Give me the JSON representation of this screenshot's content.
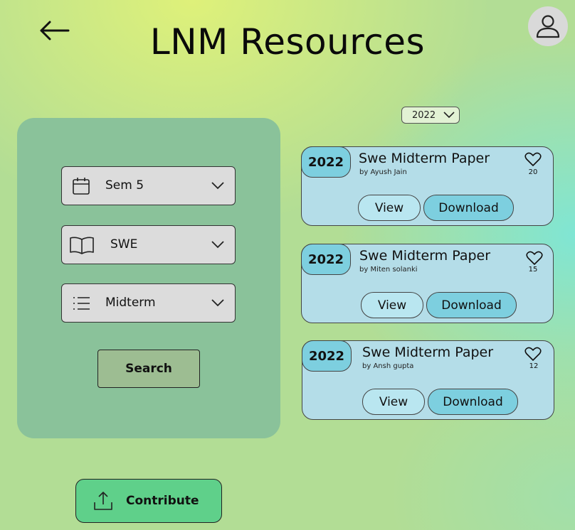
{
  "header": {
    "title": "LNM Resources",
    "back_icon": "arrow-left-icon",
    "avatar_icon": "user-icon"
  },
  "filters": {
    "semester": {
      "value": "Sem 5",
      "icon": "calendar-icon"
    },
    "subject": {
      "value": "SWE",
      "icon": "book-icon"
    },
    "exam_type": {
      "value": "Midterm",
      "icon": "list-icon"
    },
    "search_label": "Search"
  },
  "year_filter": {
    "value": "2022"
  },
  "results": [
    {
      "year": "2022",
      "title": "Swe Midterm Paper",
      "author": "by Ayush Jain",
      "likes": "20",
      "view_label": "View",
      "download_label": "Download"
    },
    {
      "year": "2022",
      "title": "Swe Midterm Paper",
      "author": "by Miten solanki",
      "likes": "15",
      "view_label": "View",
      "download_label": "Download"
    },
    {
      "year": "2022",
      "title": "Swe Midterm Paper",
      "author": "by Ansh gupta",
      "likes": "12",
      "view_label": "View",
      "download_label": "Download"
    }
  ],
  "contribute": {
    "label": "Contribute",
    "icon": "upload-icon"
  },
  "colors": {
    "panel": "#8ac29a",
    "card": "#b4dde8",
    "accent": "#7dcfdf",
    "contribute": "#5fd08a"
  }
}
